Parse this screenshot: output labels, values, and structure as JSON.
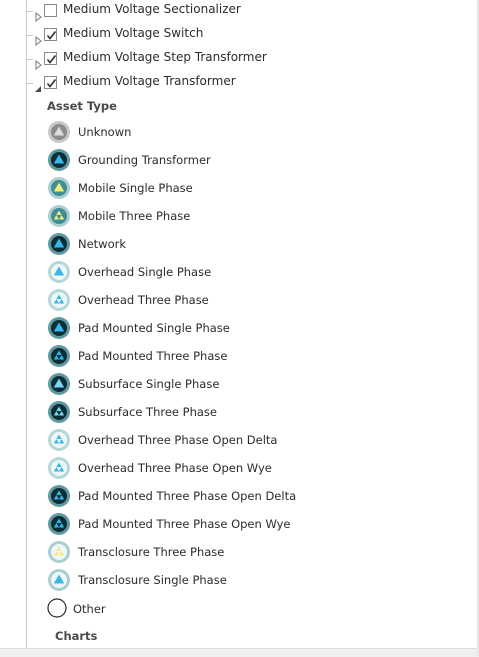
{
  "layers": [
    {
      "label": "Medium Voltage Sectionalizer",
      "checked": false,
      "expanded": false
    },
    {
      "label": "Medium Voltage Switch",
      "checked": true,
      "expanded": false
    },
    {
      "label": "Medium Voltage Step Transformer",
      "checked": true,
      "expanded": false
    },
    {
      "label": "Medium Voltage Transformer",
      "checked": true,
      "expanded": true
    }
  ],
  "group_heading": "Asset Type",
  "symbols": [
    {
      "label": "Unknown",
      "outer": "#c8c8c8",
      "inner": "#8c8c8c",
      "glyph": "#dcdcdc",
      "style": "single"
    },
    {
      "label": "Grounding Transformer",
      "outer": "#5e9aa0",
      "inner": "#0c2f36",
      "glyph": "#39b6ea",
      "style": "single"
    },
    {
      "label": "Mobile Single Phase",
      "outer": "#a9cdd0",
      "inner": "#3f8d95",
      "glyph": "#f4ec7a",
      "style": "single"
    },
    {
      "label": "Mobile Three Phase",
      "outer": "#a9cdd0",
      "inner": "#3f8d95",
      "glyph": "#f4ec7a",
      "style": "three"
    },
    {
      "label": "Network",
      "outer": "#5e9aa0",
      "inner": "#0c2f36",
      "glyph": "#39b6ea",
      "style": "single"
    },
    {
      "label": "Overhead Single Phase",
      "outer": "#b5d7da",
      "inner": "#eef6f7",
      "glyph": "#39b6ea",
      "style": "single"
    },
    {
      "label": "Overhead Three Phase",
      "outer": "#b5d7da",
      "inner": "#eef6f7",
      "glyph": "#39b6ea",
      "style": "three"
    },
    {
      "label": "Pad Mounted Single Phase",
      "outer": "#5e9aa0",
      "inner": "#0c2f36",
      "glyph": "#39b6ea",
      "style": "single"
    },
    {
      "label": "Pad Mounted Three Phase",
      "outer": "#5e9aa0",
      "inner": "#0c2f36",
      "glyph": "#39b6ea",
      "style": "three"
    },
    {
      "label": "Subsurface Single Phase",
      "outer": "#5e9aa0",
      "inner": "#0c2f36",
      "glyph": "#7fd3f4",
      "style": "single"
    },
    {
      "label": "Subsurface Three Phase",
      "outer": "#5e9aa0",
      "inner": "#0c2f36",
      "glyph": "#7fd3f4",
      "style": "three"
    },
    {
      "label": "Overhead Three Phase Open Delta",
      "outer": "#b5d7da",
      "inner": "#eef6f7",
      "glyph": "#39b6ea",
      "style": "three"
    },
    {
      "label": "Overhead Three Phase Open Wye",
      "outer": "#b5d7da",
      "inner": "#eef6f7",
      "glyph": "#39b6ea",
      "style": "three"
    },
    {
      "label": "Pad Mounted Three Phase Open Delta",
      "outer": "#5e9aa0",
      "inner": "#0c2f36",
      "glyph": "#39b6ea",
      "style": "three"
    },
    {
      "label": "Pad Mounted Three Phase Open Wye",
      "outer": "#5e9aa0",
      "inner": "#0c2f36",
      "glyph": "#39b6ea",
      "style": "three"
    },
    {
      "label": "Transclosure Three Phase",
      "outer": "#a9cdd0",
      "inner": "#eef6f7",
      "glyph": "#f4ec7a",
      "style": "three"
    },
    {
      "label": "Transclosure Single Phase",
      "outer": "#a9cdd0",
      "inner": "#eef6f7",
      "glyph": "#39b6ea",
      "style": "single"
    }
  ],
  "other_label": "Other",
  "charts_heading": "Charts",
  "icons": {
    "expander_collapsed": "triangle-right-icon",
    "expander_expanded": "triangle-down-right-icon",
    "checkbox": "checkbox",
    "symbol": "transformer-symbol-icon",
    "other": "empty-circle-icon"
  }
}
